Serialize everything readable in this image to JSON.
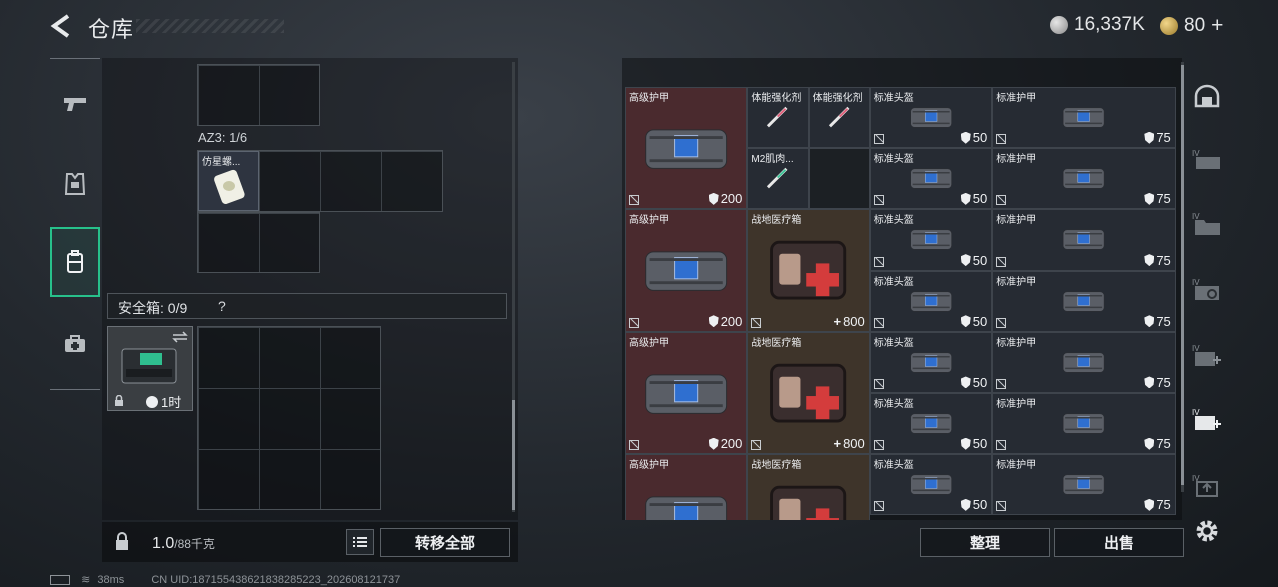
{
  "header": {
    "title": "仓库",
    "silver_amount": "16,337K",
    "gold_amount": "80",
    "gold_plus": "+"
  },
  "categories": [
    {
      "icon": "gun-icon"
    },
    {
      "icon": "armor-vest-icon"
    },
    {
      "icon": "backpack-icon"
    },
    {
      "icon": "medkit-icon"
    }
  ],
  "left": {
    "container_label": "AZ3: 1/6",
    "item1_name": "仿星螺...",
    "safe_label": "安全箱: 0/9",
    "safe_help": "?",
    "safebox_time": "1时"
  },
  "bottom_left": {
    "weight_value": "1.0",
    "weight_capacity": "/88千克",
    "transfer_all": "转移全部"
  },
  "warehouse": {
    "items": [
      {
        "name": "高级护甲",
        "value": "200",
        "type": "shield"
      },
      {
        "name": "体能强化剂",
        "value": "",
        "type": ""
      },
      {
        "name": "体能强化剂",
        "value": "",
        "type": ""
      },
      {
        "name": "标准头盔",
        "value": "50",
        "type": "shield"
      },
      {
        "name": "标准护甲",
        "value": "75",
        "type": "shield"
      },
      {
        "name": "M2肌肉...",
        "value": "",
        "type": ""
      },
      {
        "name": "战地医疗箱",
        "value": "800",
        "type": "plus"
      }
    ],
    "sort_button": "整理",
    "sell_button": "出售"
  },
  "right_icons": [
    {
      "icon": "helmet-icon"
    },
    {
      "icon": "vest-tag-icon"
    },
    {
      "icon": "folder-tag-icon"
    },
    {
      "icon": "refresh-tag-icon"
    },
    {
      "icon": "add-tag-icon"
    },
    {
      "icon": "add-tag-active-icon"
    },
    {
      "icon": "export-tag-icon"
    },
    {
      "icon": "settings-gear-icon"
    }
  ],
  "footer": {
    "ping": "38ms",
    "uid": "CN UID:18715543862183828522​3_20260812173​7"
  }
}
